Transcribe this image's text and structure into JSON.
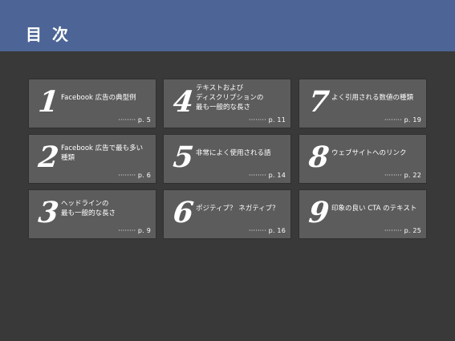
{
  "header": {
    "title": "目 次"
  },
  "toc": [
    {
      "number": "1",
      "label": "Facebook 広告の典型例",
      "page": "········ p. 5"
    },
    {
      "number": "2",
      "label": "Facebook 広告で最も多い種類",
      "page": "········ p. 6"
    },
    {
      "number": "3",
      "label": "ヘッドラインの\n最も一般的な長さ",
      "page": "········ p. 9"
    },
    {
      "number": "4",
      "label": "テキストおよび\nディスクリプションの\n最も一般的な長さ",
      "page": "········ p. 11"
    },
    {
      "number": "5",
      "label": "非常によく使用される語",
      "page": "········ p. 14"
    },
    {
      "number": "6",
      "label": "ポジティブ？ ネガティブ？",
      "page": "········ p. 16"
    },
    {
      "number": "7",
      "label": "よく引用される数値の種類",
      "page": "········ p. 19"
    },
    {
      "number": "8",
      "label": "ウェブサイトへのリンク",
      "page": "········ p. 22"
    },
    {
      "number": "9",
      "label": "印象の良い CTA のテキスト",
      "page": "········ p. 25"
    }
  ]
}
